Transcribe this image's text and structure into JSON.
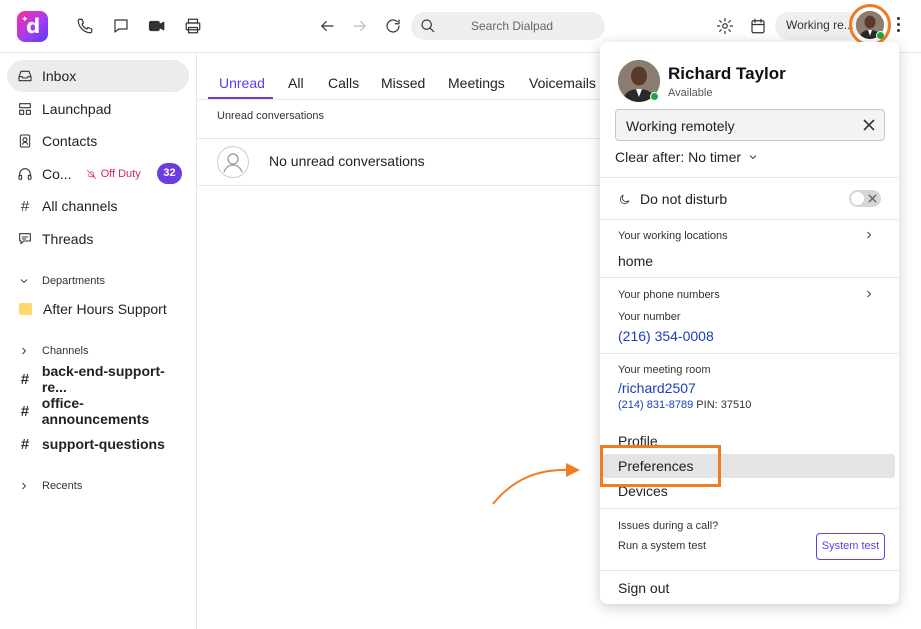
{
  "topbar": {
    "search_placeholder": "Search Dialpad",
    "status_pill": "Working re..."
  },
  "sidebar": {
    "items": [
      {
        "label": "Inbox"
      },
      {
        "label": "Launchpad"
      },
      {
        "label": "Contacts"
      },
      {
        "label": "Co...",
        "status": "Off Duty",
        "badge": "32"
      },
      {
        "label": "All channels"
      },
      {
        "label": "Threads"
      }
    ],
    "departments_header": "Departments",
    "departments": [
      "After Hours Support"
    ],
    "channels_header": "Channels",
    "channels": [
      "back-end-support-re...",
      "office-announcements",
      "support-questions"
    ],
    "recents_header": "Recents"
  },
  "main": {
    "tabs": [
      "Unread",
      "All",
      "Calls",
      "Missed",
      "Meetings",
      "Voicemails"
    ],
    "active_tab": "Unread",
    "section_label": "Unread conversations",
    "empty_message": "No unread conversations"
  },
  "profile_menu": {
    "name": "Richard Taylor",
    "availability": "Available",
    "status_text": "Working remotely",
    "clear_after": "Clear after: No timer",
    "dnd_label": "Do not disturb",
    "dnd_on": false,
    "locations_label": "Your working locations",
    "location_value": "home",
    "phone_label": "Your phone numbers",
    "your_number_label": "Your number",
    "phone_number": "(216) 354-0008",
    "meeting_label": "Your meeting room",
    "meeting_link": "/richard2507",
    "meeting_phone": "(214) 831-8789",
    "meeting_pin": "PIN: 37510",
    "menu_items": [
      "Profile",
      "Preferences",
      "Devices"
    ],
    "issues_title": "Issues during a call?",
    "issues_sub": "Run a system test",
    "system_test_button": "System test",
    "sign_out": "Sign out"
  },
  "colors": {
    "accent": "#6b3de0",
    "highlight": "#f07c22",
    "link": "#1a3ebf",
    "offduty": "#d6245c",
    "online": "#1ea445"
  }
}
